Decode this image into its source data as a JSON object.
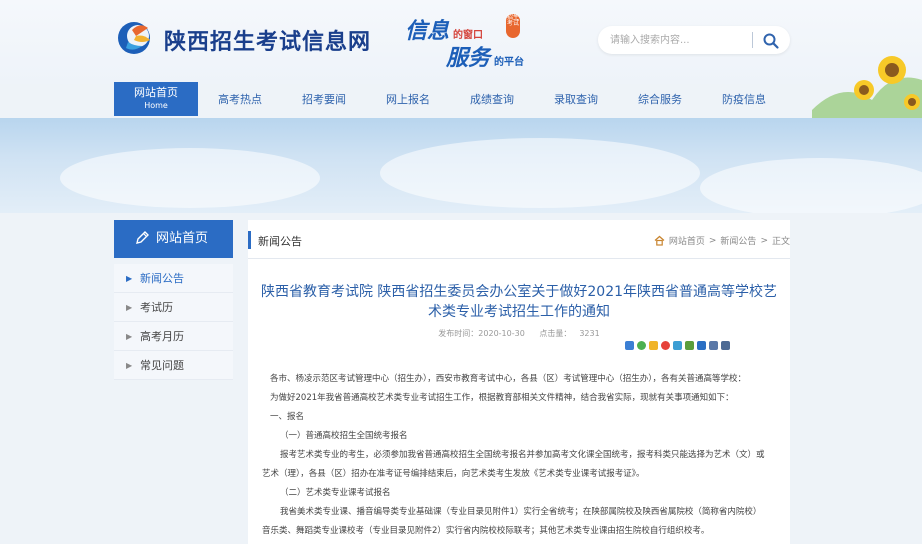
{
  "header": {
    "site_name": "陕西招生考试信息网",
    "slogan_line1": "信息",
    "slogan_line1_sub": "的窗口",
    "slogan_line2": "服务",
    "slogan_line2_sub": "的平台",
    "badge_text": "招生考试",
    "search_placeholder": "请输入搜索内容...",
    "search_icon": "search-icon"
  },
  "nav": {
    "items": [
      {
        "label": "网站首页",
        "sub": "Home"
      },
      {
        "label": "高考热点"
      },
      {
        "label": "招考要闻"
      },
      {
        "label": "网上报名"
      },
      {
        "label": "成绩查询"
      },
      {
        "label": "录取查询"
      },
      {
        "label": "综合服务"
      },
      {
        "label": "防疫信息"
      }
    ]
  },
  "sidebar": {
    "title": "网站首页",
    "items": [
      {
        "label": "新闻公告"
      },
      {
        "label": "考试历"
      },
      {
        "label": "高考月历"
      },
      {
        "label": "常见问题"
      }
    ]
  },
  "breadcrumb": {
    "section": "新闻公告",
    "path": [
      "网站首页",
      "新闻公告",
      "正文"
    ],
    "separator": ">"
  },
  "article": {
    "title_line1": "陕西省教育考试院 陕西省招生委员会办公室关于做好2021年陕西省普通高等学校艺",
    "title_line2": "术类专业考试招生工作的通知",
    "publish_label": "发布时间：",
    "publish_date": "2020-10-30",
    "views_label": "点击量：",
    "views": "3231",
    "paragraphs": [
      "各市、杨凌示范区考试管理中心（招生办），西安市教育考试中心，各县（区）考试管理中心（招生办），各有关普通高等学校：",
      "为做好2021年我省普通高校艺术类专业考试招生工作，根据教育部相关文件精神，结合我省实际，现就有关事项通知如下：",
      "一、报名",
      "（一）普通高校招生全国统考报名",
      "报考艺术类专业的考生，必须参加我省普通高校招生全国统考报名并参加高考文化课全国统考，报考科类只能选择为艺术（文）或",
      "艺术（理），各县（区）招办在准考证号编排结束后，向艺术类考生发放《艺术类专业课考试报考证》。",
      "（二）艺术类专业课考试报名",
      "我省美术类专业课、播音编导类专业基础课（专业目录见附件1）实行全省统考；在陕部属院校及陕西省属院校（简称省内院校）",
      "音乐类、舞蹈类专业课校考（专业目录见附件2）实行省内院校校际联考；其他艺术类专业课由招生院校自行组织校考。"
    ]
  },
  "colors": {
    "primary": "#2b6cc4",
    "title_blue": "#2b5fa8",
    "site_name": "#1a3f8c"
  }
}
